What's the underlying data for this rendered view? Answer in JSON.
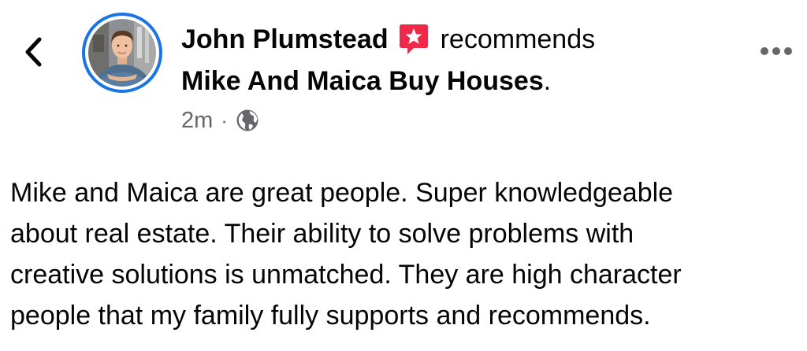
{
  "header": {
    "author_name": "John Plumstead",
    "action_text": "recommends",
    "page_name": "Mike And Maica Buy Houses",
    "page_suffix": ".",
    "timestamp": "2m",
    "separator": "·",
    "privacy_icon": "globe-icon",
    "recommend_icon": "recommend-star-badge-icon",
    "more_icon": "more-horizontal-icon",
    "back_icon": "chevron-left-icon"
  },
  "body": {
    "lines": [
      "Mike and Maica are great people. Super knowledgeable",
      "about real estate. Their ability to solve problems with",
      "creative solutions is unmatched. They are high character",
      "people that my family fully supports and recommends."
    ]
  },
  "colors": {
    "avatar_ring": "#1b74e4",
    "recommend_badge": "#f02849",
    "secondary_text": "#65676b",
    "primary_text": "#050505"
  }
}
